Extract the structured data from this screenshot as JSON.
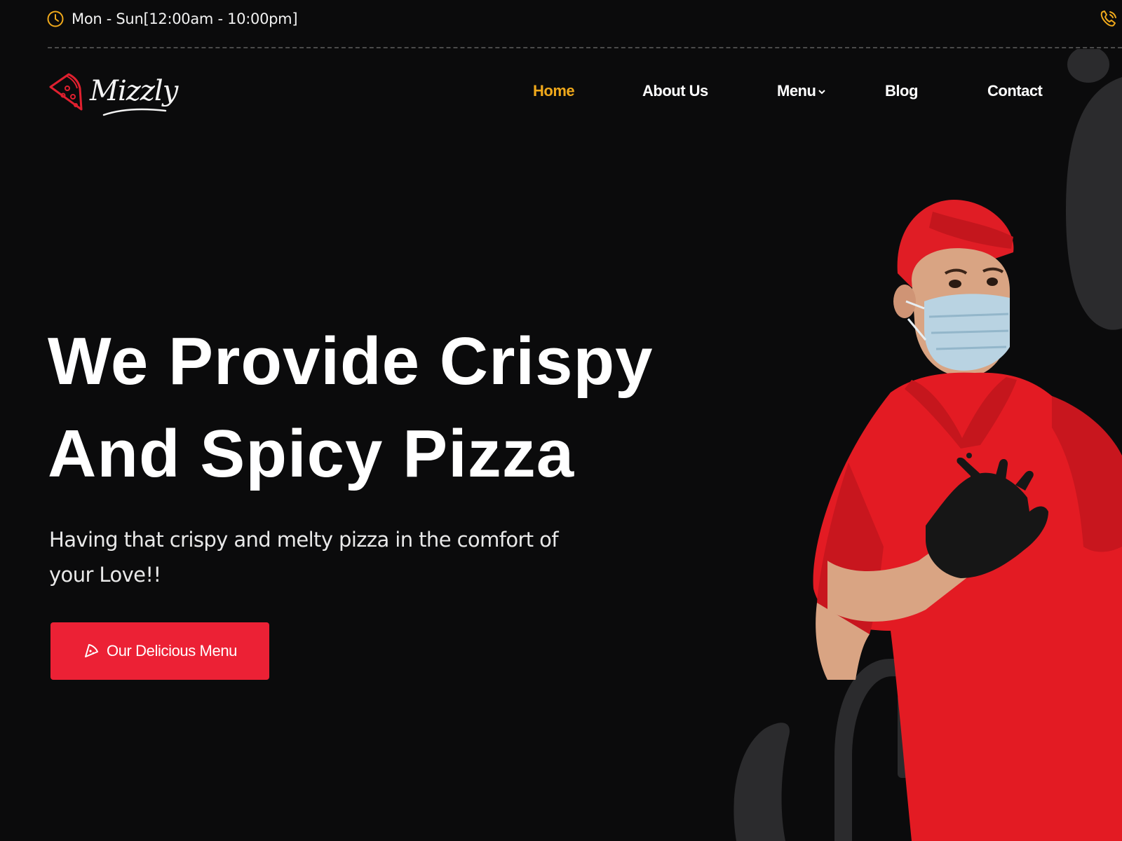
{
  "topbar": {
    "hours_text": "Mon - Sun[12:00am - 10:00pm]",
    "hours_icon": "clock-icon",
    "phone_icon": "phone-icon"
  },
  "header": {
    "logo_text": "Mizzly",
    "logo_icon": "pizza-slice-icon",
    "nav": [
      {
        "label": "Home",
        "active": true
      },
      {
        "label": "About Us",
        "active": false
      },
      {
        "label": "Menu",
        "active": false,
        "has_dropdown": true
      },
      {
        "label": "Blog",
        "active": false
      },
      {
        "label": "Contact",
        "active": false
      }
    ]
  },
  "hero": {
    "title_line1": "We Provide Crispy",
    "title_line2": "And Spicy Pizza",
    "subtitle": "Having that crispy and melty pizza in the comfort of your Love!!",
    "cta_label": "Our Delicious Menu",
    "cta_icon": "pizza-slice-icon"
  },
  "colors": {
    "background": "#0b0b0c",
    "accent_orange": "#f0a91b",
    "accent_red": "#ec2135",
    "text": "#ffffff"
  }
}
